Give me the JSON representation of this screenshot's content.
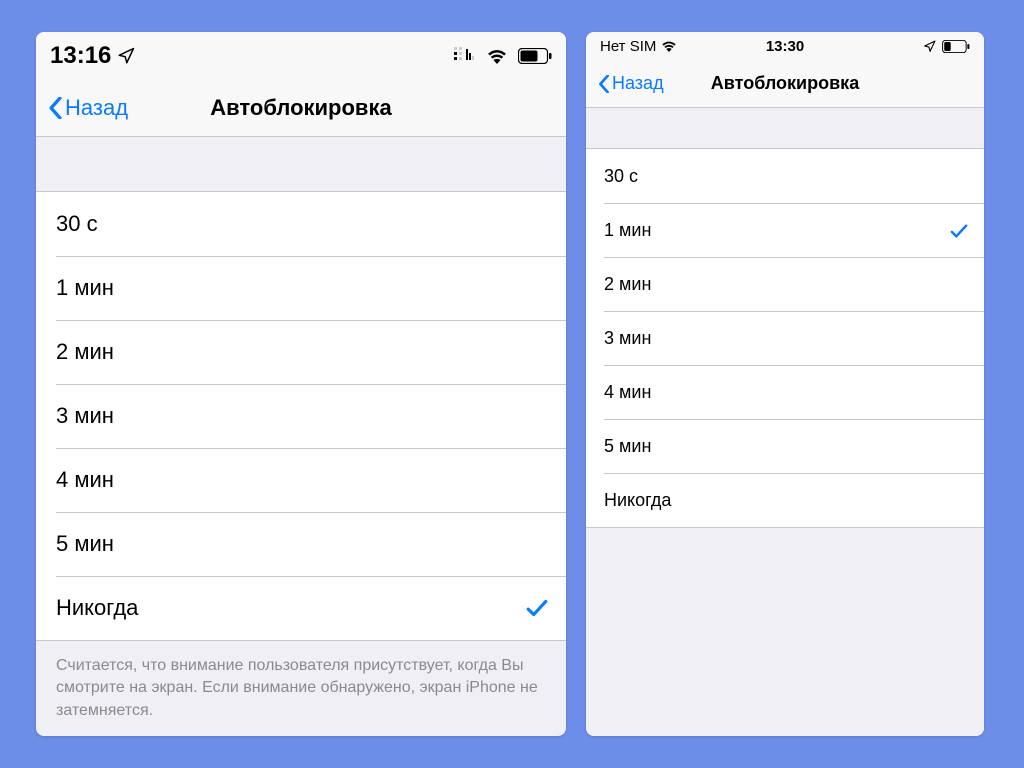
{
  "left": {
    "status": {
      "time": "13:16",
      "showLocation": true
    },
    "nav": {
      "back": "Назад",
      "title": "Автоблокировка"
    },
    "options": [
      {
        "label": "30 с",
        "selected": false
      },
      {
        "label": "1 мин",
        "selected": false
      },
      {
        "label": "2 мин",
        "selected": false
      },
      {
        "label": "3 мин",
        "selected": false
      },
      {
        "label": "4 мин",
        "selected": false
      },
      {
        "label": "5 мин",
        "selected": false
      },
      {
        "label": "Никогда",
        "selected": true
      }
    ],
    "footer": "Считается, что внимание пользователя присутствует, когда Вы смотрите на экран. Если внимание обнаружено, экран iPhone не затемняется."
  },
  "right": {
    "status": {
      "carrier": "Нет SIM",
      "time": "13:30"
    },
    "nav": {
      "back": "Назад",
      "title": "Автоблокировка"
    },
    "options": [
      {
        "label": "30 с",
        "selected": false
      },
      {
        "label": "1 мин",
        "selected": true
      },
      {
        "label": "2 мин",
        "selected": false
      },
      {
        "label": "3 мин",
        "selected": false
      },
      {
        "label": "4 мин",
        "selected": false
      },
      {
        "label": "5 мин",
        "selected": false
      },
      {
        "label": "Никогда",
        "selected": false
      }
    ]
  },
  "colors": {
    "accent": "#0a7aff"
  }
}
